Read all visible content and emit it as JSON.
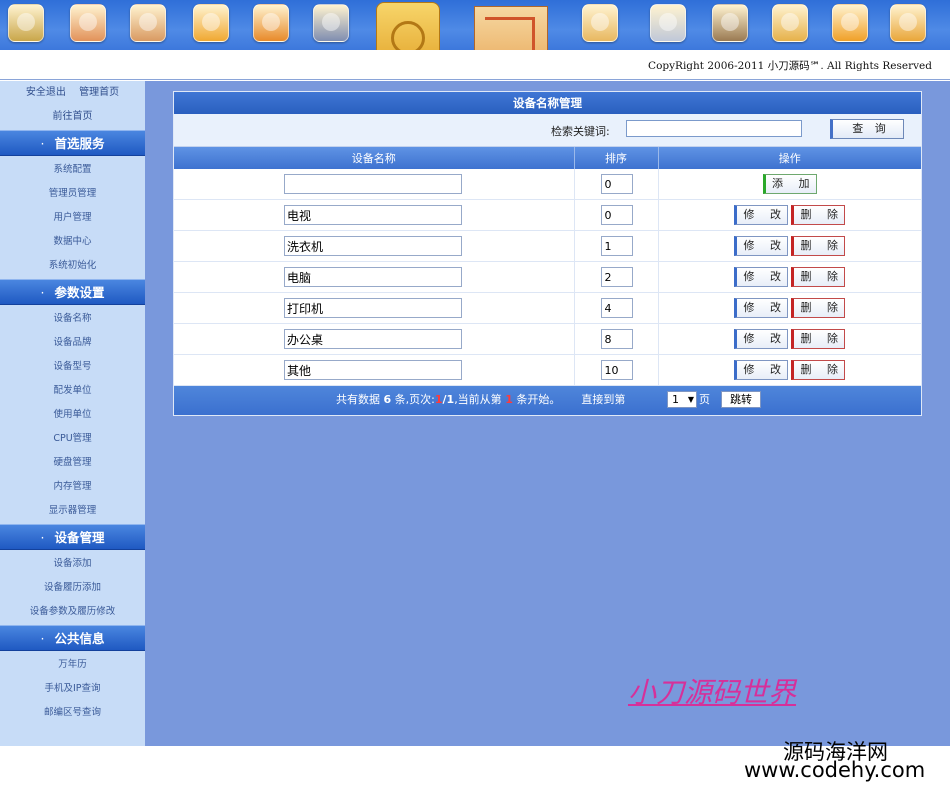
{
  "header": {
    "icons": [
      "tools-icon",
      "user-icon",
      "users-icon",
      "ai-file-icon",
      "briefcase-icon",
      "network-card-icon",
      "hard-disk-icon",
      "circuit-board-icon",
      "cpu-chip-icon",
      "gear-icon",
      "clapperboard-icon",
      "cube-icon",
      "calendar-icon",
      "link-icon"
    ],
    "copyright": "CopyRight 2006-2011 小刀源码℠. All Rights Reserved"
  },
  "sidebar": {
    "top_links": [
      "安全退出",
      "管理首页"
    ],
    "home_link": "前往首页",
    "sections": [
      {
        "title": "首选服务",
        "items": [
          "系统配置",
          "管理员管理",
          "用户管理",
          "数据中心",
          "系统初始化"
        ]
      },
      {
        "title": "参数设置",
        "items": [
          "设备名称",
          "设备品牌",
          "设备型号",
          "配发单位",
          "使用单位",
          "CPU管理",
          "硬盘管理",
          "内存管理",
          "显示器管理"
        ]
      },
      {
        "title": "设备管理",
        "items": [
          "设备添加",
          "设备履历添加",
          "设备参数及履历修改"
        ]
      },
      {
        "title": "公共信息",
        "items": [
          "万年历",
          "手机及IP查询",
          "邮编区号查询"
        ]
      }
    ]
  },
  "panel": {
    "title": "设备名称管理",
    "search": {
      "label": "检索关键词:",
      "value": "",
      "button": "查 询"
    },
    "columns": [
      "设备名称",
      "排序",
      "操作"
    ],
    "new_row": {
      "name": "",
      "sort": "0",
      "add_label": "添 加"
    },
    "rows": [
      {
        "name": "电视",
        "sort": "0"
      },
      {
        "name": "洗衣机",
        "sort": "1"
      },
      {
        "name": "电脑",
        "sort": "2"
      },
      {
        "name": "打印机",
        "sort": "4"
      },
      {
        "name": "办公桌",
        "sort": "8"
      },
      {
        "name": "其他",
        "sort": "10"
      }
    ],
    "edit_label": "修 改",
    "delete_label": "删 除",
    "footer": {
      "prefix": "共有数据 ",
      "total": "6",
      "mid1": " 条,页次:",
      "page_cur": "1",
      "page_total": "/1",
      "mid2": ",当前从第 ",
      "start": "1",
      "mid3": " 条开始。",
      "jump_label": "直接到第",
      "page_select": "1",
      "page_unit": "页",
      "go_button": "跳转"
    }
  },
  "brand_text": "小刀源码世界",
  "watermark": {
    "line1": "源码海洋网",
    "line2": "www.codehy.com"
  }
}
